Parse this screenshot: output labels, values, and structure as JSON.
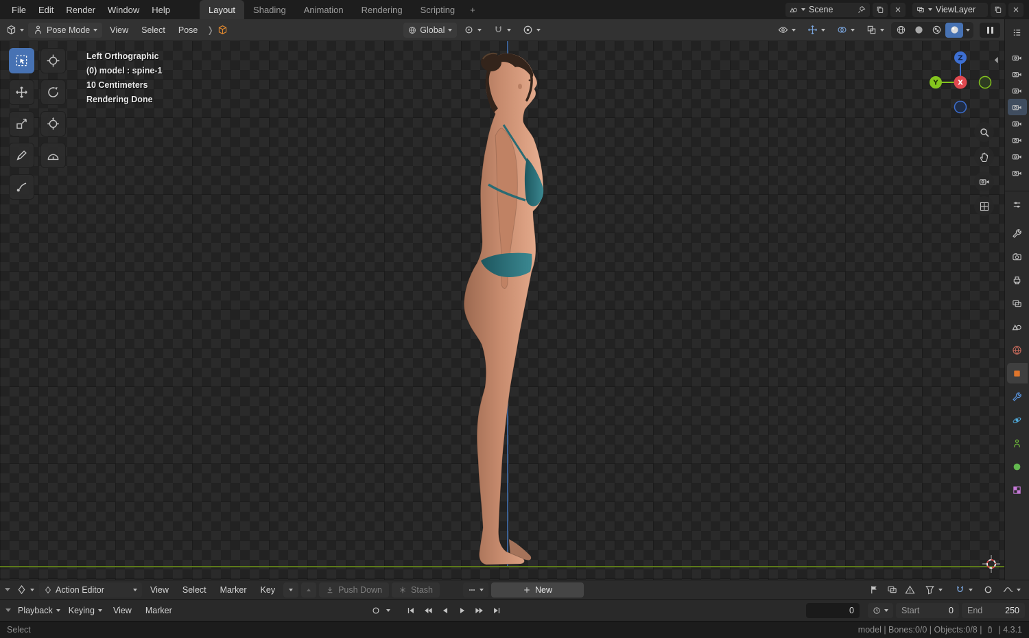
{
  "colors": {
    "accent": "#4772b3",
    "axis-x": "#e0484f",
    "axis-y": "#84c41e",
    "axis-z": "#3d6fd2",
    "teal": "#2e6f78"
  },
  "topbar": {
    "menus": [
      "File",
      "Edit",
      "Render",
      "Window",
      "Help"
    ],
    "workspaces": [
      "Layout",
      "Shading",
      "Animation",
      "Rendering",
      "Scripting"
    ],
    "add_workspace": "+",
    "scene_label": "Scene",
    "viewlayer_label": "ViewLayer"
  },
  "viewport": {
    "mode": "Pose Mode",
    "menus": [
      "View",
      "Select",
      "Pose"
    ],
    "orientation": "Global",
    "overlay_lines": [
      "Left Orthographic",
      "(0) model : spine-1",
      "10 Centimeters",
      "Rendering Done"
    ],
    "gizmo": {
      "x": "X",
      "y": "Y",
      "z": "Z"
    }
  },
  "dopesheet": {
    "editor": "Action Editor",
    "menus": [
      "View",
      "Select",
      "Marker",
      "Key"
    ],
    "push_down": "Push Down",
    "stash": "Stash",
    "new_action": "New"
  },
  "timeline": {
    "menus": [
      "Playback",
      "Keying",
      "View",
      "Marker"
    ],
    "frame": "0",
    "start_label": "Start",
    "start_value": "0",
    "end_label": "End",
    "end_value": "250"
  },
  "statusbar": {
    "mode_hint": "Select",
    "info": "model | Bones:0/0 | Objects:0/8 |",
    "version": "| 4.3.1"
  }
}
